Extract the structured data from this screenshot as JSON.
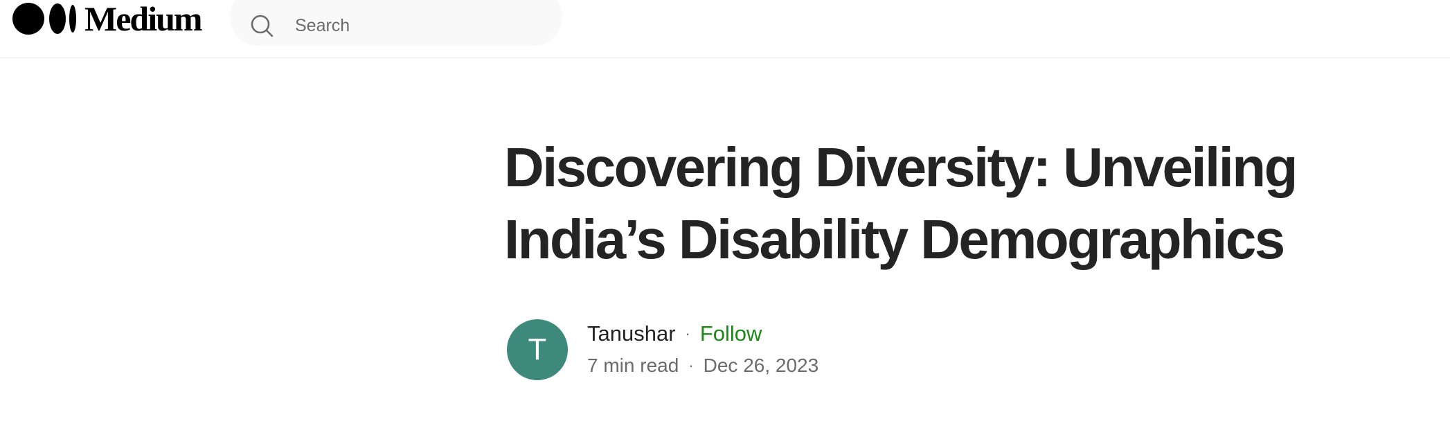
{
  "header": {
    "logo_text": "Medium",
    "logo_icon": "medium-logo-icon",
    "search_icon": "search-icon",
    "search_placeholder": "Search"
  },
  "article": {
    "title_line1": "Discovering Diversity: Unveiling",
    "title_line2": "India’s Disability Demographics",
    "author": {
      "name": "Tanushar",
      "avatar_initial": "T",
      "avatar_color": "#3d8a7c",
      "follow_label": "Follow",
      "follow_color": "#1a8917"
    },
    "separator": "·",
    "read_time": "7 min read",
    "date": "Dec 26, 2023"
  }
}
